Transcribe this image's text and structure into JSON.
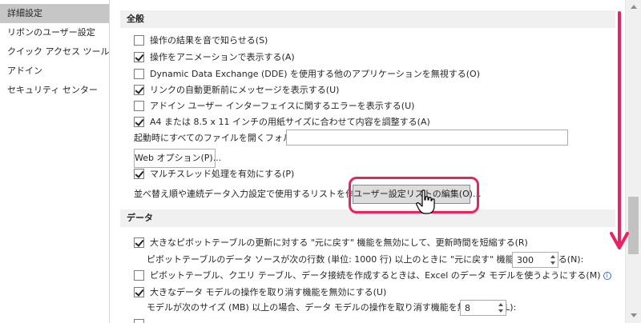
{
  "sidebar": {
    "items": [
      {
        "label": "詳細設定",
        "selected": true
      },
      {
        "label": "リボンのユーザー設定",
        "selected": false
      },
      {
        "label": "クイック アクセス ツール バー",
        "selected": false
      },
      {
        "label": "アドイン",
        "selected": false
      },
      {
        "label": "セキュリティ センター",
        "selected": false
      }
    ]
  },
  "general": {
    "title": "全般",
    "options": [
      {
        "label": "操作の結果を音で知らせる(S)",
        "checked": false
      },
      {
        "label": "操作をアニメーションで表示する(A)",
        "checked": true
      },
      {
        "label": "Dynamic Data Exchange (DDE) を使用する他のアプリケーションを無視する(O)",
        "checked": false
      },
      {
        "label": "リンクの自動更新前にメッセージを表示する(U)",
        "checked": true
      },
      {
        "label": "アドイン ユーザー インターフェイスに関するエラーを表示する(U)",
        "checked": false
      },
      {
        "label": "A4 または 8.5 x 11 インチの用紙サイズに合わせて内容を調整する(A)",
        "checked": true
      }
    ],
    "startup_folder_label": "起動時にすべてのファイルを開くフォルダー(L):",
    "startup_folder_value": "",
    "web_options_button": "Web オプション(P)...",
    "multithread_label": "マルチスレッド処理を有効にする(P)",
    "multithread_checked": true,
    "custom_list_label": "並べ替え順や連続データ入力設定で使用するリストを作成します:",
    "custom_list_button": "ユーザー設定リストの編集(O)..."
  },
  "data": {
    "title": "データ",
    "pivot_undo_label": "大きなピボットテーブルの更新に対する \"元に戻す\" 機能を無効にして、更新時間を短縮する(R)",
    "pivot_undo_checked": true,
    "pivot_rows_label": "ピボットテーブルのデータ ソースが次の行数 (単位: 1000 行) 以上のときに \"元に戻す\" 機能を無効にする(N):",
    "pivot_rows_value": "300",
    "data_model_label": "ピボットテーブル、クエリ テーブル、データ接続を作成するときは、Excel のデータ モデルを使うようにする(M)",
    "data_model_checked": false,
    "model_undo_label": "大きなデータ モデルの操作を取り消す機能を無効にする(U)",
    "model_undo_checked": true,
    "model_size_label": "モデルが次のサイズ (MB) 以上の場合、データ モデルの操作を取り消す機能を無効にする(L):",
    "model_size_value": "8"
  },
  "colors": {
    "highlight": "#e8245e",
    "selected_sidebar": "#c6c6c6",
    "section_header": "#f0f0f0"
  }
}
